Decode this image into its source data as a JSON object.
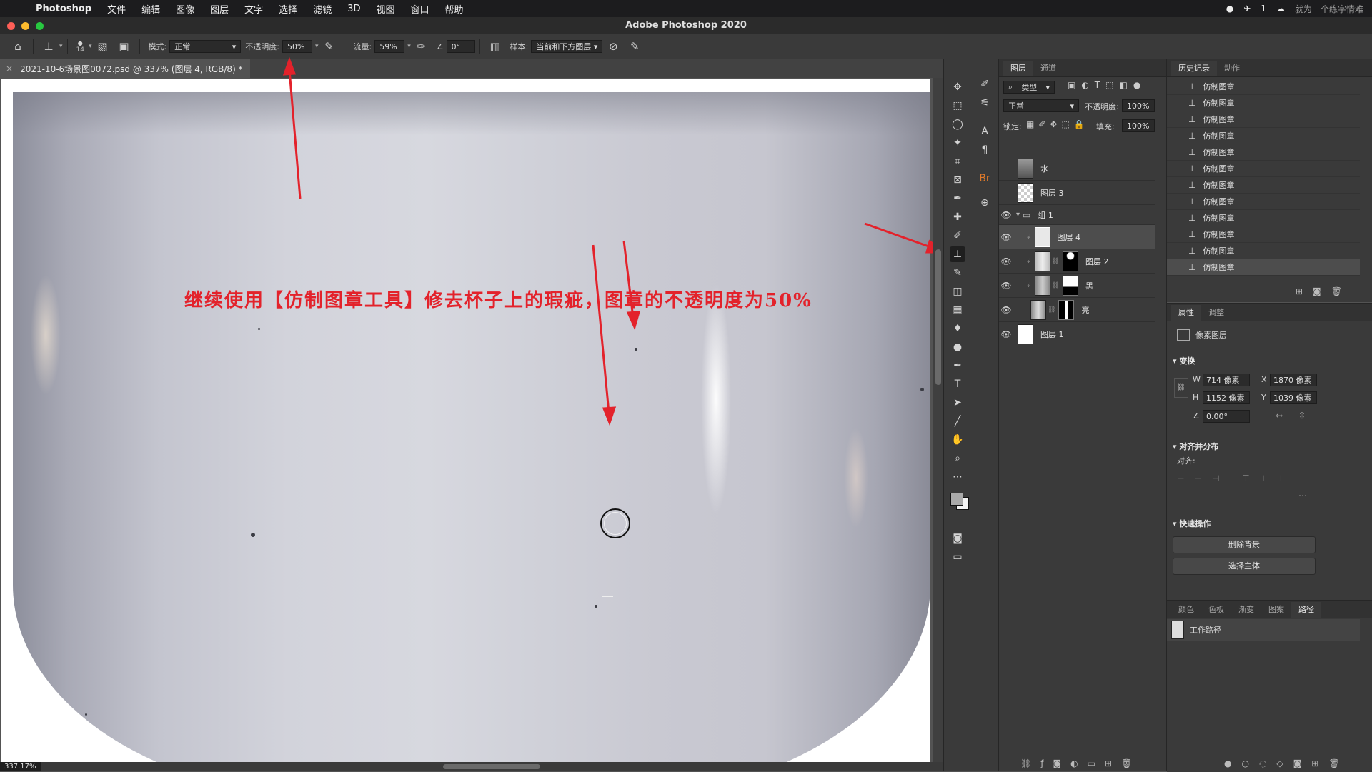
{
  "menubar": {
    "app": "Photoshop",
    "items": [
      "文件",
      "编辑",
      "图像",
      "图层",
      "文字",
      "选择",
      "滤镜",
      "3D",
      "视图",
      "窗口",
      "帮助"
    ],
    "notification_count": "1",
    "watermark": "就为一个练字情难"
  },
  "window": {
    "title": "Adobe Photoshop 2020"
  },
  "options": {
    "brush_size": "14",
    "mode": "正常",
    "opacity_label": "不透明度:",
    "opacity": "50%",
    "flow_label": "流量:",
    "flow": "59%",
    "angle": "0°",
    "sample": "当前和下方图层"
  },
  "document": {
    "tab_title": "2021-10-6场景图0072.psd @ 337% (图层 4, RGB/8) *",
    "zoom": "337.17%",
    "annotation": "继续使用【仿制图章工具】修去杯子上的瑕疵，图章的不透明度为50%"
  },
  "layers_panel": {
    "tabs": [
      "图层",
      "通道"
    ],
    "filter": "类型",
    "blend": "正常",
    "opacity_label": "不透明度:",
    "opacity": "100%",
    "lock_label": "锁定:",
    "fill_label": "填充:",
    "fill": "100%",
    "layers": [
      {
        "name": "水",
        "visible": false
      },
      {
        "name": "图层 3",
        "visible": false
      },
      {
        "name": "组 1",
        "visible": true
      },
      {
        "name": "图层 4",
        "visible": true
      },
      {
        "name": "图层 2",
        "visible": true
      },
      {
        "name": "黑",
        "visible": true
      },
      {
        "name": "亮",
        "visible": true
      },
      {
        "name": "图层 1",
        "visible": true
      }
    ]
  },
  "history_panel": {
    "tabs": [
      "历史记录",
      "动作"
    ],
    "items": [
      "仿制图章",
      "仿制图章",
      "仿制图章",
      "仿制图章",
      "仿制图章",
      "仿制图章",
      "仿制图章",
      "仿制图章",
      "仿制图章",
      "仿制图章",
      "仿制图章",
      "仿制图章"
    ]
  },
  "properties_panel": {
    "tabs": [
      "属性",
      "调整"
    ],
    "type": "像素图层",
    "transform_title": "变换",
    "w": "714 像素",
    "x": "1870 像素",
    "h": "1152 像素",
    "y": "1039 像素",
    "angle": "0.00°",
    "align_title": "对齐并分布",
    "align_label": "对齐:",
    "quick_title": "快速操作",
    "btn_remove_bg": "删除背景",
    "btn_select_subject": "选择主体"
  },
  "paths_panel": {
    "tabs": [
      "颜色",
      "色板",
      "渐变",
      "图案",
      "路径"
    ],
    "item": "工作路径"
  }
}
